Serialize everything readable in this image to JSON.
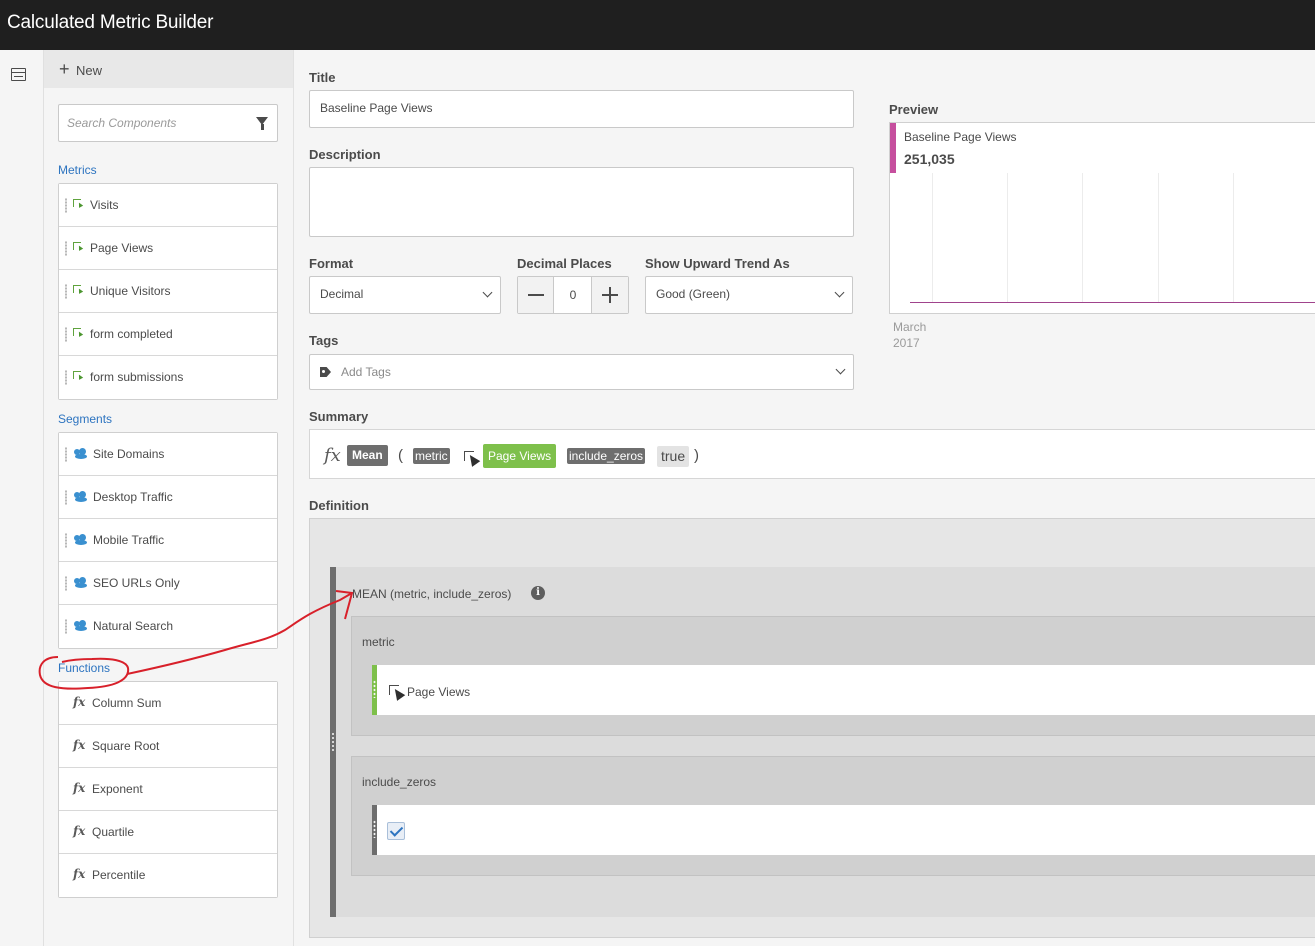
{
  "app": {
    "title": "Calculated Metric Builder"
  },
  "sidebar": {
    "new_label": "New",
    "search_placeholder": "Search Components",
    "sections": {
      "metrics": "Metrics",
      "segments": "Segments",
      "functions": "Functions"
    },
    "metrics": [
      "Visits",
      "Page Views",
      "Unique Visitors",
      "form completed",
      "form submissions"
    ],
    "segments": [
      "Site Domains",
      "Desktop Traffic",
      "Mobile Traffic",
      "SEO URLs Only",
      "Natural Search"
    ],
    "functions": [
      "Column Sum",
      "Square Root",
      "Exponent",
      "Quartile",
      "Percentile"
    ]
  },
  "form": {
    "title_label": "Title",
    "title_value": "Baseline Page Views",
    "description_label": "Description",
    "description_value": "",
    "format_label": "Format",
    "format_value": "Decimal",
    "decimal_label": "Decimal Places",
    "decimal_value": "0",
    "trend_label": "Show Upward Trend As",
    "trend_value": "Good (Green)",
    "tags_label": "Tags",
    "tags_placeholder": "Add Tags",
    "summary_label": "Summary",
    "definition_label": "Definition"
  },
  "summary": {
    "fx": "fx",
    "function": "Mean",
    "open_paren": "(",
    "arg1_name": "metric",
    "arg1_value": "Page Views",
    "arg2_name": "include_zeros",
    "arg2_value": "true",
    "close_paren": ")"
  },
  "definition": {
    "signature": "MEAN (metric, include_zeros)",
    "info_glyph": "i",
    "metric_arg_label": "metric",
    "metric_arg_value": "Page Views",
    "include_zeros_label": "include_zeros",
    "include_zeros_checked": true
  },
  "preview": {
    "label": "Preview",
    "series_name": "Baseline Page Views",
    "value": "251,035",
    "axis_month": "March",
    "axis_year": "2017",
    "series_color": "#c64f9e"
  },
  "colors": {
    "accent_blue": "#2d74c0",
    "metric_green": "#7ec04b",
    "annotation_red": "#d8202a"
  }
}
